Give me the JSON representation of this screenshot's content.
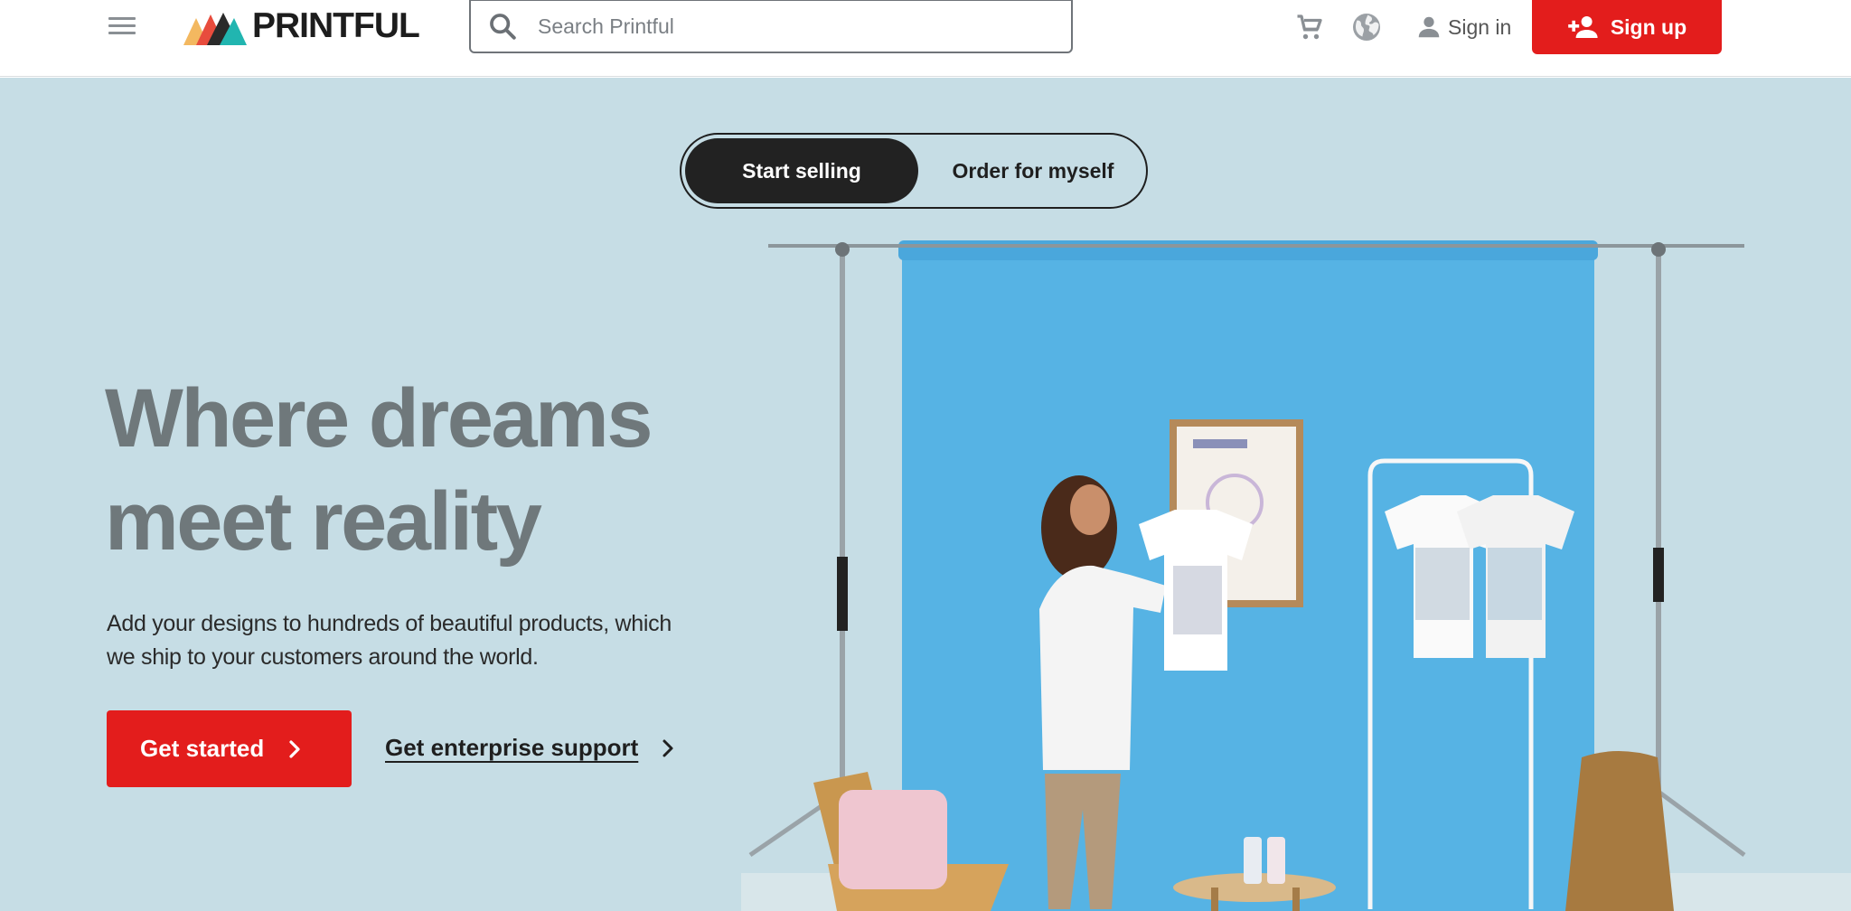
{
  "header": {
    "logo_text": "PRINTFUL",
    "search_placeholder": "Search Printful",
    "signin_label": "Sign in",
    "signup_label": "Sign up"
  },
  "hero": {
    "toggle": {
      "active": "Start selling",
      "inactive": "Order for myself"
    },
    "headline": [
      "Where dreams",
      "meet reality"
    ],
    "subtext": "Add your designs to hundreds of beautiful products, which we ship to your customers around the world.",
    "cta_label": "Get started",
    "enterprise_label": "Get enterprise support"
  },
  "icons": [
    "menu-icon",
    "logo-mark-icon",
    "search-icon",
    "cart-icon",
    "globe-icon",
    "person-icon",
    "add-person-icon",
    "chevron-right-icon"
  ],
  "colors": {
    "brand_red": "#e31d1c",
    "hero_bg": "#c6dde5",
    "headline_gray": "#6f787b",
    "backdrop_blue": "#56b3e4"
  }
}
